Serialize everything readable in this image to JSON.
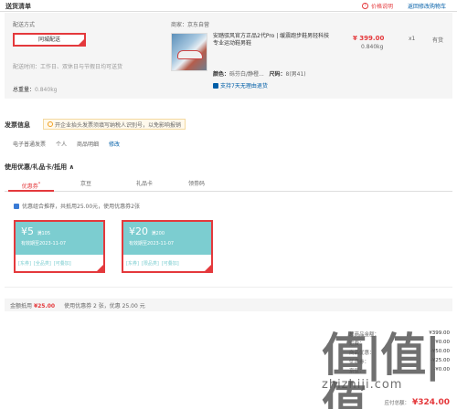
{
  "header": {
    "title": "送货清单",
    "price_note": "价格说明",
    "back_link": "返回修改购物车"
  },
  "delivery": {
    "label": "配送方式",
    "method": "同城配送",
    "time": "配送时间：工作日、双休日与节假日均可送货",
    "weight_label": "总重量：",
    "weight": "0.840kg"
  },
  "product": {
    "seller": "商家：京东自营",
    "name": "安踏驭风官方正品2代Pro | 缓震跑步鞋男轻科技专业运动鞋男鞋",
    "attr_color_label": "颜色：",
    "attr_color": "砾芬白/静橙...",
    "attr_size_label": "尺码：",
    "attr_size": "8(男41)",
    "service": "支持7天无理由退货",
    "price": "¥ 399.00",
    "weight": "0.840kg",
    "quantity": "x1",
    "stock": "有货"
  },
  "invoice": {
    "title": "发票信息",
    "tip": "开企业抬头发票须填写纳税人识别号，以免影响报销",
    "type": "电子普通发票",
    "holder": "个人",
    "content": "商品明细",
    "edit": "修改"
  },
  "coupons": {
    "title": "使用优惠/礼品卡/抵用 ∧",
    "tabs": [
      {
        "label": "优惠券",
        "badge": "*"
      },
      {
        "label": "京豆"
      },
      {
        "label": "礼品卡"
      },
      {
        "label": "领劵码"
      }
    ],
    "hint": "优惠组合推荐，共抵用25.00元，使用优惠券2张",
    "items": [
      {
        "symbol": "¥",
        "amount": "5",
        "cond": "满105",
        "date": "有效期至2023-11-07",
        "links": [
          "[东券]",
          "[全品类]",
          "[可叠加]"
        ]
      },
      {
        "symbol": "¥",
        "amount": "20",
        "cond": "满200",
        "date": "有效期至2023-11-07",
        "links": [
          "[东券]",
          "[限品类]",
          "[可叠加]"
        ]
      }
    ],
    "summary_label": "金额抵用",
    "summary_amount": "¥25.00",
    "summary_text": "使用优惠券 2 张，优惠 25.00 元"
  },
  "totals": {
    "rows": [
      {
        "k": "总商品金额：",
        "v": "¥399.00"
      },
      {
        "k": "运费：",
        "v": "¥0.00"
      },
      {
        "k": "商品优惠：",
        "v": "-¥50.00"
      },
      {
        "k": "优惠券：",
        "v": "-¥25.00"
      },
      {
        "k": "京豆：",
        "v": "-¥0.00"
      }
    ],
    "pay_label": "应付总额：",
    "pay_value": "¥324.00"
  },
  "watermark": {
    "glyphs": "值|值|值",
    "url": "zhizhiji.com"
  },
  "colors": {
    "accent": "#e4393c",
    "link": "#005ea7",
    "coupon_bg": "#7ccdd0"
  }
}
